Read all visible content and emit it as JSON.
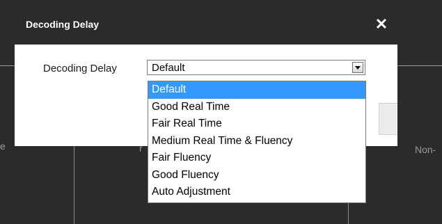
{
  "dialog": {
    "title": "Decoding Delay",
    "close_symbol": "✕",
    "field_label": "Decoding Delay",
    "selected_value": "Default"
  },
  "dropdown": {
    "options": [
      {
        "label": "Default",
        "selected": true
      },
      {
        "label": "Good Real Time",
        "selected": false
      },
      {
        "label": "Fair Real Time",
        "selected": false
      },
      {
        "label": "Medium Real Time & Fluency",
        "selected": false
      },
      {
        "label": "Fair Fluency",
        "selected": false
      },
      {
        "label": "Good Fluency",
        "selected": false
      },
      {
        "label": "Auto Adjustment",
        "selected": false
      }
    ]
  },
  "background": {
    "fragment_left": "e",
    "fragment_mid": "r",
    "fragment_right": "Non-"
  },
  "colors": {
    "backdrop": "#2b2b2b",
    "selection": "#3399ff"
  }
}
